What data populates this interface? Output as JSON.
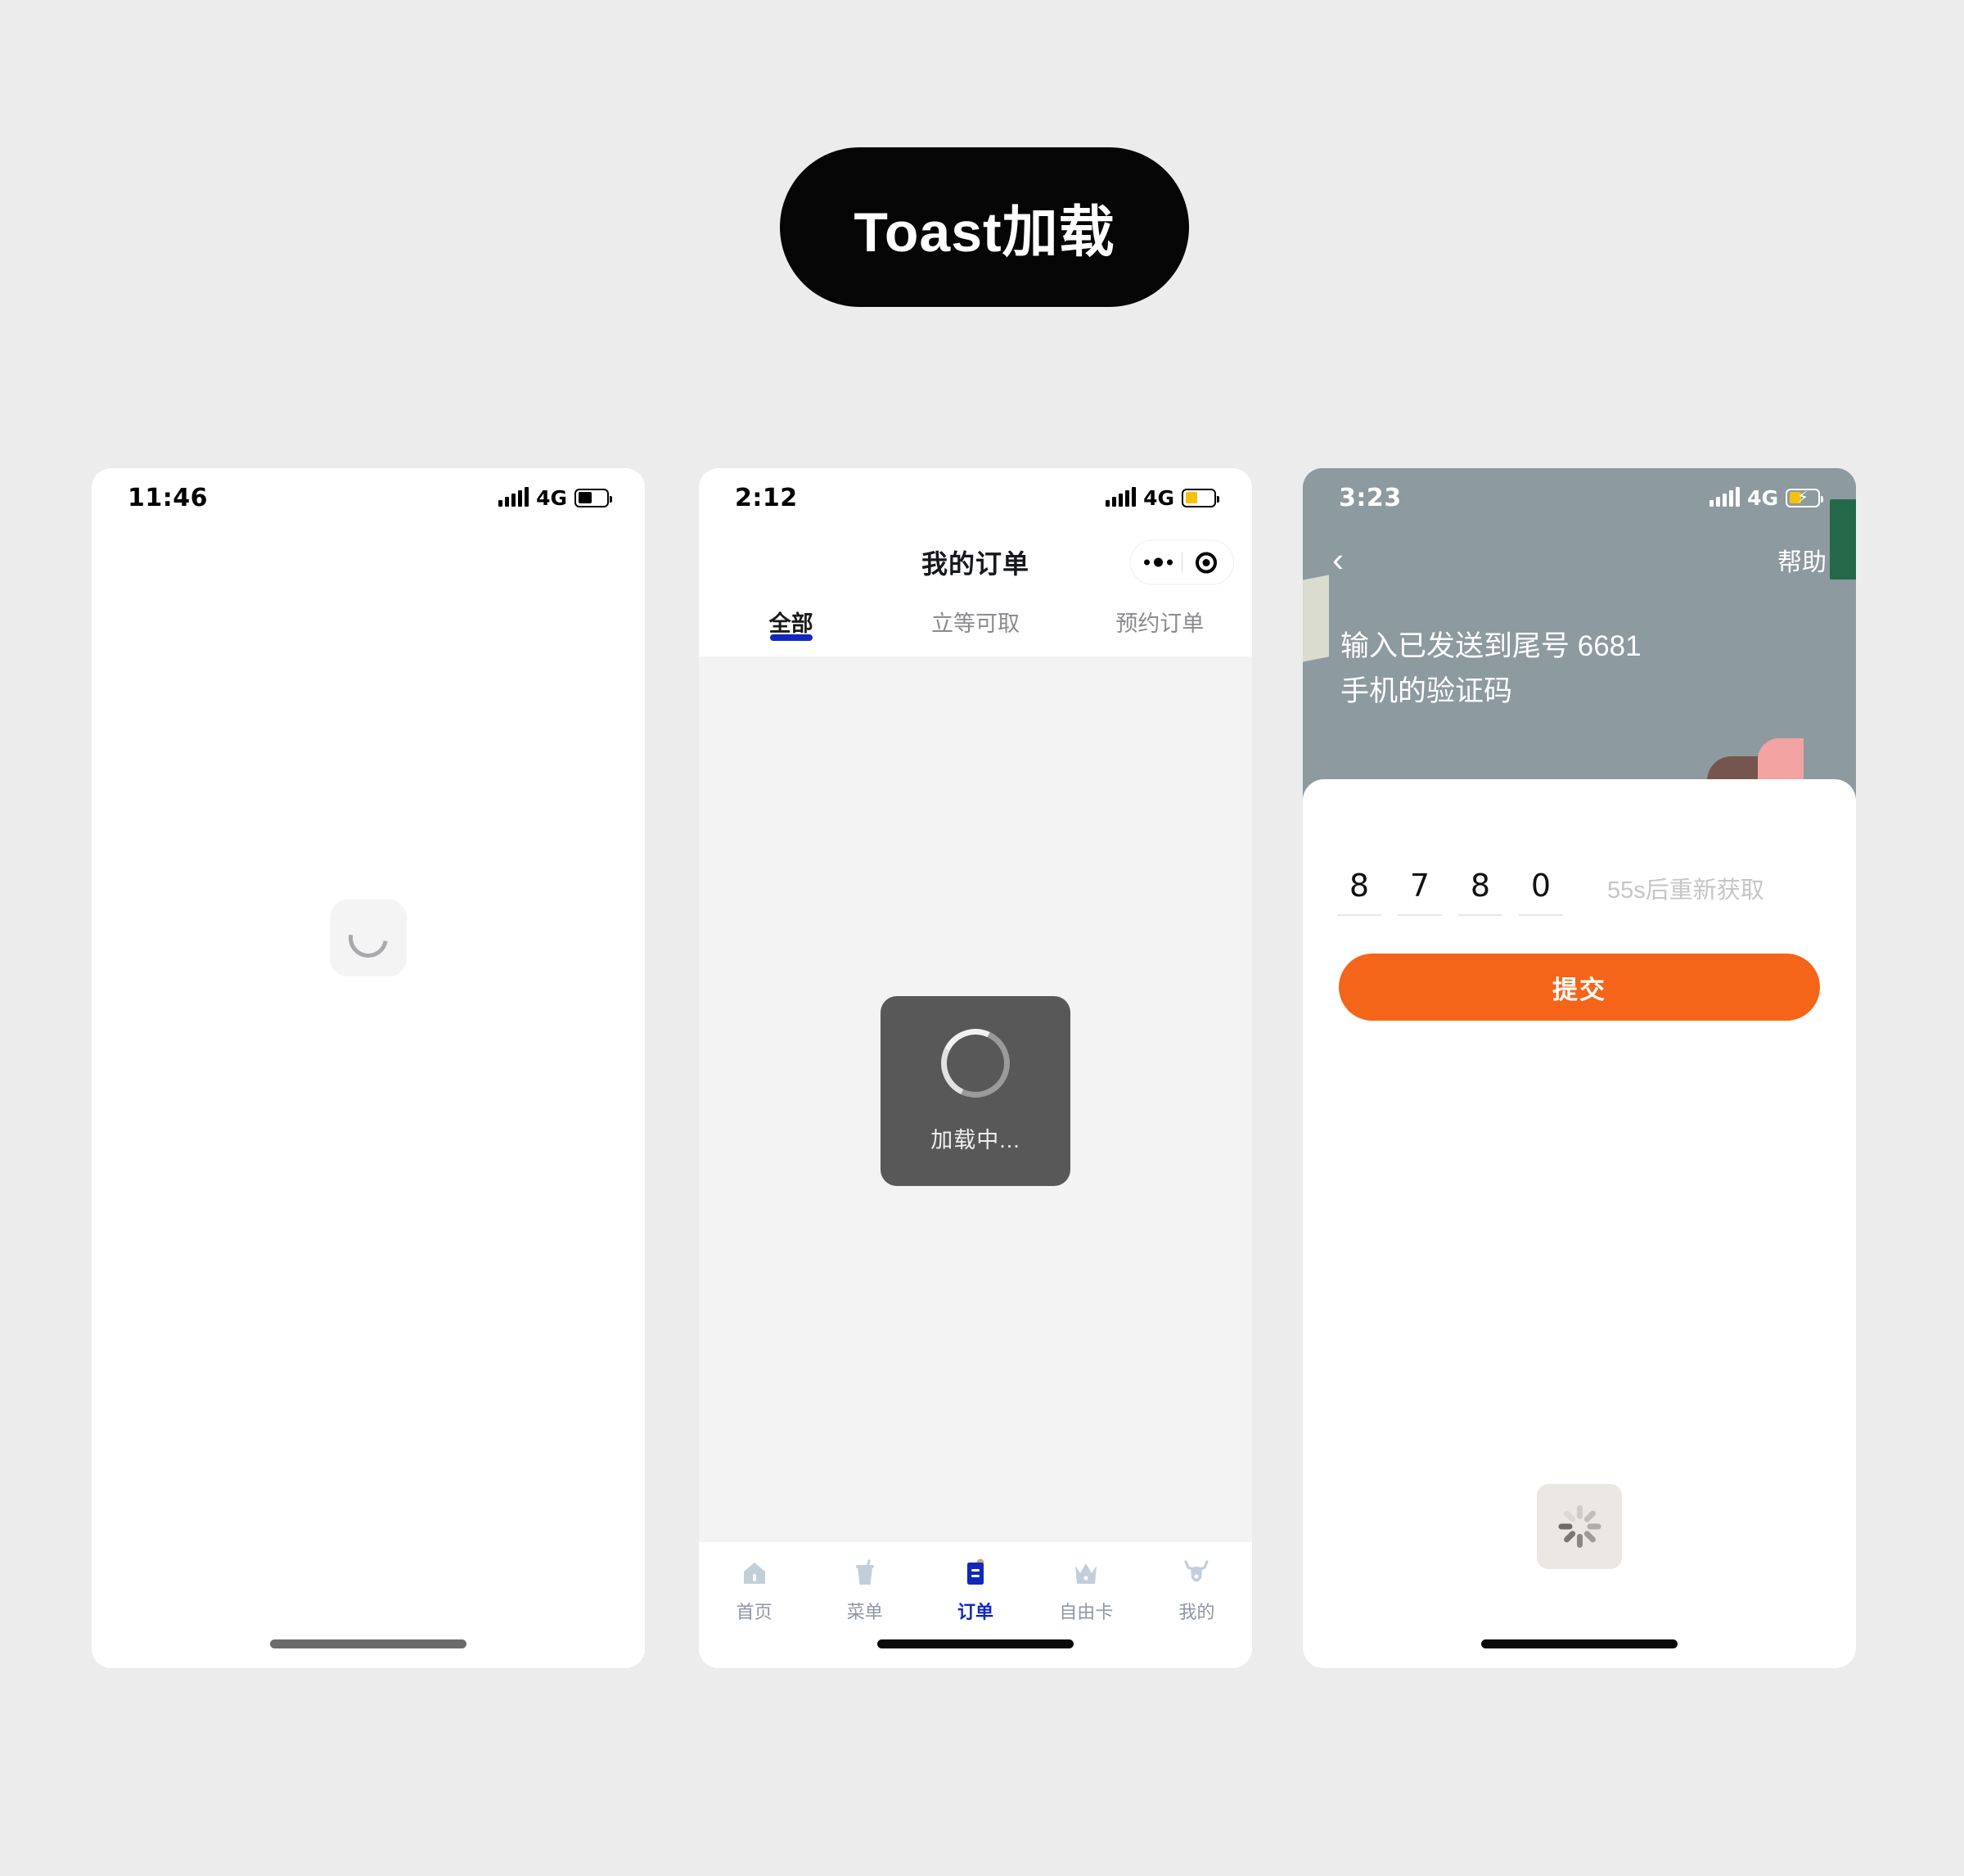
{
  "title_badge": {
    "label": "Toast加载"
  },
  "colors": {
    "page_background": "#ececec",
    "badge_background": "#050505",
    "accent_blue": "#1028bd",
    "accent_orange": "#f4651a",
    "toast_background": "#585858",
    "hero_background": "#8d9aa0",
    "battery_yellow": "#f5c211",
    "deco_green": "#236949",
    "deco_pink": "#f4a3a3",
    "deco_brown": "#75564e",
    "deco_cream": "#d9dccf"
  },
  "screens": [
    {
      "id": "blank-loading",
      "status": {
        "time": "11:46",
        "network": "4G",
        "signal_icon": "signal-bars-icon",
        "battery_icon": "battery-icon",
        "battery_level": 50,
        "charging": false
      },
      "loader": {
        "icon": "arc-spinner-icon",
        "label": ""
      },
      "home_indicator": "home-indicator"
    },
    {
      "id": "my-orders",
      "status": {
        "time": "2:12",
        "network": "4G",
        "signal_icon": "signal-bars-icon",
        "battery_icon": "battery-icon",
        "battery_level": 45,
        "charging": false
      },
      "nav": {
        "title": "我的订单",
        "capsule": {
          "more_icon": "more-dots-icon",
          "target_icon": "target-circle-icon"
        }
      },
      "tabs": [
        {
          "label": "全部",
          "active": true
        },
        {
          "label": "立等可取",
          "active": false
        },
        {
          "label": "预约订单",
          "active": false
        }
      ],
      "toast": {
        "icon": "ring-spinner-icon",
        "label": "加载中..."
      },
      "tabbar": [
        {
          "label": "首页",
          "icon": "home-icon",
          "active": false
        },
        {
          "label": "菜单",
          "icon": "cup-icon",
          "active": false
        },
        {
          "label": "订单",
          "icon": "clipboard-icon",
          "active": true
        },
        {
          "label": "自由卡",
          "icon": "crown-icon",
          "active": false
        },
        {
          "label": "我的",
          "icon": "deer-icon",
          "active": false
        }
      ],
      "home_indicator": "home-indicator"
    },
    {
      "id": "sms-verify",
      "status": {
        "time": "3:23",
        "network": "4G",
        "signal_icon": "signal-bars-icon",
        "battery_icon": "battery-charging-icon",
        "battery_level": 45,
        "charging": true
      },
      "nav": {
        "back_icon": "back-chevron-icon",
        "help_label": "帮助"
      },
      "hero": {
        "line1": "输入已发送到尾号 6681",
        "line2": "手机的验证码"
      },
      "code": {
        "digits": [
          "8",
          "7",
          "8",
          "0"
        ],
        "resend_label": "55s后重新获取"
      },
      "submit": {
        "label": "提交"
      },
      "loader": {
        "icon": "spoke-spinner-icon"
      },
      "home_indicator": "home-indicator"
    }
  ]
}
